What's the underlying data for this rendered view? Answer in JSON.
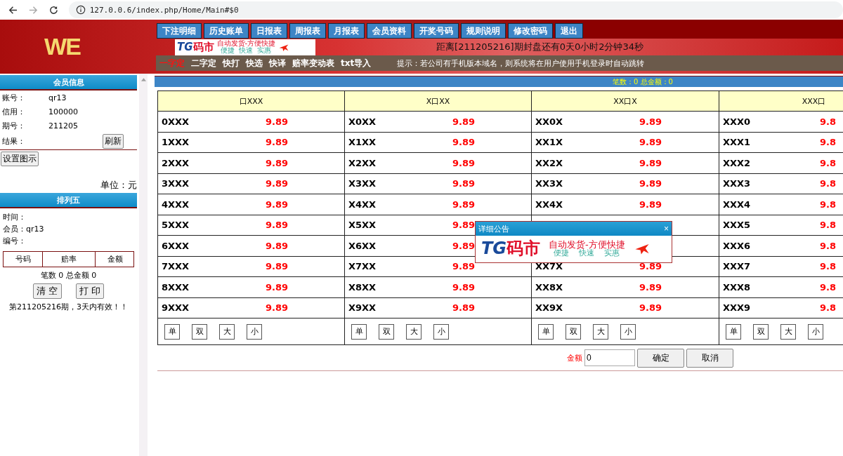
{
  "browser": {
    "url": "127.0.0.6/index.php/Home/Main#$0"
  },
  "header": {
    "logo": "WE",
    "nav": [
      "下注明细",
      "历史账单",
      "日报表",
      "周报表",
      "月报表",
      "会员资料",
      "开奖号码",
      "规则说明",
      "修改密码",
      "退出"
    ],
    "banner": {
      "brand_a": "TG",
      "brand_b": "码市",
      "slogan": "自动发货-方便快捷",
      "tags": [
        "便捷",
        "快速",
        "实惠"
      ]
    },
    "countdown": "距离[211205216]期封盘还有0天0小时2分钟34秒"
  },
  "subnav": {
    "tabs": [
      {
        "label": "一字定",
        "selected": true
      },
      {
        "label": "二字定",
        "selected": false
      },
      {
        "label": "快打",
        "selected": false
      },
      {
        "label": "快选",
        "selected": false
      },
      {
        "label": "快译",
        "selected": false
      },
      {
        "label": "赔率变动表",
        "selected": false
      },
      {
        "label": "txt导入",
        "selected": false
      }
    ],
    "hint": "提示：若公司有手机版本域名，则系统将在用户使用手机登录时自动跳转"
  },
  "member_panel": {
    "title": "会员信息",
    "fields": [
      {
        "label": "账号：",
        "value": "qr13"
      },
      {
        "label": "信用：",
        "value": "100000"
      },
      {
        "label": "期号：",
        "value": "211205"
      }
    ],
    "result_label": "结果：",
    "refresh_button": "刷新",
    "legend_button": "设置图示",
    "unit": "单位：元"
  },
  "bet_panel": {
    "title": "排列五",
    "lines": [
      "时间：",
      "会员：qr13",
      "编号："
    ],
    "columns": [
      "号码",
      "赔率",
      "金额"
    ],
    "summary": "笔数 0 总金额 0",
    "buttons": [
      "清 空",
      "打 印"
    ],
    "notice": "第211205216期，3天内有效！！"
  },
  "main": {
    "totals": "笔数：0 总金额：0",
    "columns": [
      "口XXX",
      "X口XX",
      "XX口X",
      "XXX口"
    ],
    "rows": [
      {
        "cells": [
          {
            "code": "0XXX",
            "odds": "9.89"
          },
          {
            "code": "X0XX",
            "odds": "9.89"
          },
          {
            "code": "XX0X",
            "odds": "9.89"
          },
          {
            "code": "XXX0",
            "odds": "9.8"
          }
        ]
      },
      {
        "cells": [
          {
            "code": "1XXX",
            "odds": "9.89"
          },
          {
            "code": "X1XX",
            "odds": "9.89"
          },
          {
            "code": "XX1X",
            "odds": "9.89"
          },
          {
            "code": "XXX1",
            "odds": "9.8"
          }
        ]
      },
      {
        "cells": [
          {
            "code": "2XXX",
            "odds": "9.89"
          },
          {
            "code": "X2XX",
            "odds": "9.89"
          },
          {
            "code": "XX2X",
            "odds": "9.89"
          },
          {
            "code": "XXX2",
            "odds": "9.8"
          }
        ]
      },
      {
        "cells": [
          {
            "code": "3XXX",
            "odds": "9.89"
          },
          {
            "code": "X3XX",
            "odds": "9.89"
          },
          {
            "code": "XX3X",
            "odds": "9.89"
          },
          {
            "code": "XXX3",
            "odds": "9.8"
          }
        ]
      },
      {
        "cells": [
          {
            "code": "4XXX",
            "odds": "9.89"
          },
          {
            "code": "X4XX",
            "odds": "9.89"
          },
          {
            "code": "XX4X",
            "odds": "9.89"
          },
          {
            "code": "XXX4",
            "odds": "9.8"
          }
        ]
      },
      {
        "cells": [
          {
            "code": "5XXX",
            "odds": "9.89"
          },
          {
            "code": "X5XX",
            "odds": "9.89"
          },
          null,
          {
            "code": "XXX5",
            "odds": "9.8"
          }
        ]
      },
      {
        "cells": [
          {
            "code": "6XXX",
            "odds": "9.89"
          },
          {
            "code": "X6XX",
            "odds": "9.89"
          },
          null,
          {
            "code": "XXX6",
            "odds": "9.8"
          }
        ]
      },
      {
        "cells": [
          {
            "code": "7XXX",
            "odds": "9.89"
          },
          {
            "code": "X7XX",
            "odds": "9.89"
          },
          {
            "code": "XX7X",
            "odds": "9.89"
          },
          {
            "code": "XXX7",
            "odds": "9.8"
          }
        ]
      },
      {
        "cells": [
          {
            "code": "8XXX",
            "odds": "9.89"
          },
          {
            "code": "X8XX",
            "odds": "9.89"
          },
          {
            "code": "XX8X",
            "odds": "9.89"
          },
          {
            "code": "XXX8",
            "odds": "9.8"
          }
        ]
      },
      {
        "cells": [
          {
            "code": "9XXX",
            "odds": "9.89"
          },
          {
            "code": "X9XX",
            "odds": "9.89"
          },
          {
            "code": "XX9X",
            "odds": "9.89"
          },
          {
            "code": "XXX9",
            "odds": "9.8"
          }
        ]
      }
    ],
    "quick_picks": [
      [
        "单",
        "双",
        "大",
        "小"
      ],
      [
        "单",
        "双",
        "大",
        "小"
      ],
      [
        "单",
        "双",
        "大",
        "小"
      ],
      [
        "单",
        "双",
        "大",
        "小"
      ]
    ],
    "amount_label": "金额",
    "amount": "0",
    "buttons": [
      "确定",
      "取消"
    ]
  },
  "popup": {
    "title": "详细公告",
    "close": "×",
    "banner": {
      "brand_a": "TG",
      "brand_b": "码市",
      "slogan": "自动发货-方便快捷",
      "tags": [
        "便捷",
        "快速",
        "实惠"
      ]
    }
  }
}
